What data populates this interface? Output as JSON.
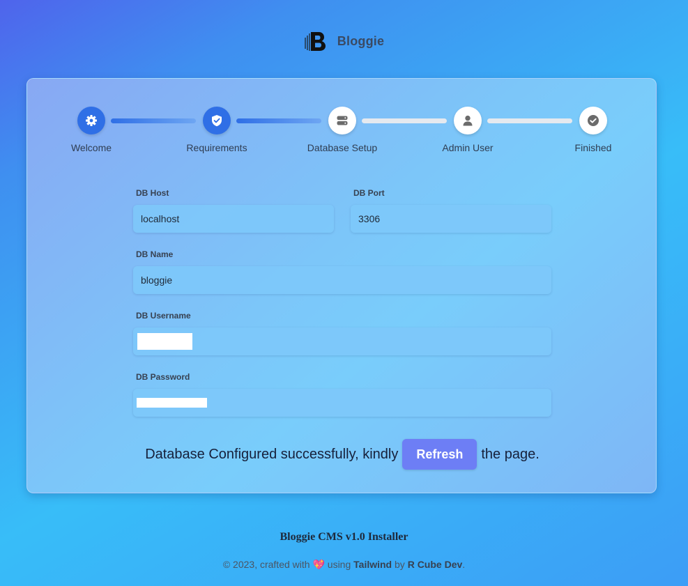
{
  "brand": {
    "name": "Bloggie",
    "logo_letter": "B",
    "logo_icon": "bloggie-logo"
  },
  "steps": [
    {
      "label": "Welcome",
      "icon": "gear-icon",
      "state": "done"
    },
    {
      "label": "Requirements",
      "icon": "shield-check-icon",
      "state": "done"
    },
    {
      "label": "Database Setup",
      "icon": "server-icon",
      "state": "current"
    },
    {
      "label": "Admin User",
      "icon": "user-icon",
      "state": "todo"
    },
    {
      "label": "Finished",
      "icon": "check-circle-icon",
      "state": "todo"
    }
  ],
  "form": {
    "db_host": {
      "label": "DB Host",
      "value": "localhost"
    },
    "db_port": {
      "label": "DB Port",
      "value": "3306"
    },
    "db_name": {
      "label": "DB Name",
      "value": "bloggie"
    },
    "db_username": {
      "label": "DB Username",
      "value": ""
    },
    "db_password": {
      "label": "DB Password",
      "value": ""
    }
  },
  "message": {
    "before": "Database Configured successfully, kindly",
    "button": "Refresh",
    "after": "the page."
  },
  "footer": {
    "title": "Bloggie CMS v1.0 Installer",
    "prefix": "© 2023, crafted with",
    "heart": "💖",
    "using": "using",
    "framework": "Tailwind",
    "by": "by",
    "author": "R Cube Dev",
    "end": "."
  },
  "colors": {
    "accent": "#2f6fe6",
    "button": "#6d7ef5",
    "inactive_connector": "#e5e9ef",
    "icon_gray": "#6b6b6b"
  }
}
